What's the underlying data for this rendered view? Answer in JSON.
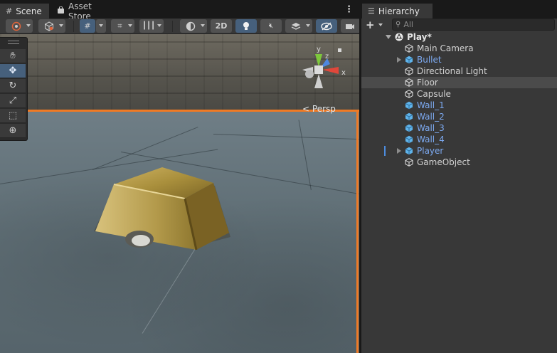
{
  "scene_panel": {
    "tabs": [
      {
        "label": "Scene",
        "icon": "grid-icon",
        "active": true
      },
      {
        "label": "Asset Store",
        "icon": "bag-icon",
        "active": false
      }
    ],
    "toolbar": {
      "mode_2d_label": "2D"
    },
    "tools": [
      "hand-tool",
      "move-tool",
      "rotate-tool",
      "scale-tool",
      "rect-tool",
      "transform-tool"
    ],
    "active_tool": "move-tool",
    "gizmo": {
      "axis_x": "x",
      "axis_y": "y",
      "axis_z": "z",
      "projection_label": "Persp"
    },
    "colors": {
      "selection_outline": "#f07a25",
      "active_button": "#46607c"
    }
  },
  "hierarchy": {
    "tab_label": "Hierarchy",
    "add_button_label": "+",
    "search_placeholder": "All",
    "scene_name": "Play*",
    "items": [
      {
        "label": "Main Camera",
        "icon": "gameobject-icon",
        "prefab": false,
        "expandable": false
      },
      {
        "label": "Bullet",
        "icon": "prefab-icon",
        "prefab": true,
        "expandable": true
      },
      {
        "label": "Directional Light",
        "icon": "gameobject-icon",
        "prefab": false,
        "expandable": false
      },
      {
        "label": "Floor",
        "icon": "gameobject-icon",
        "prefab": false,
        "expandable": false,
        "highlighted": true
      },
      {
        "label": "Capsule",
        "icon": "gameobject-icon",
        "prefab": false,
        "expandable": false
      },
      {
        "label": "Wall_1",
        "icon": "prefab-icon",
        "prefab": true,
        "expandable": false
      },
      {
        "label": "Wall_2",
        "icon": "prefab-icon",
        "prefab": true,
        "expandable": false
      },
      {
        "label": "Wall_3",
        "icon": "prefab-icon",
        "prefab": true,
        "expandable": false
      },
      {
        "label": "Wall_4",
        "icon": "prefab-icon",
        "prefab": true,
        "expandable": false
      },
      {
        "label": "Player",
        "icon": "prefab-icon",
        "prefab": true,
        "expandable": true,
        "modified": true
      },
      {
        "label": "GameObject",
        "icon": "gameobject-icon",
        "prefab": false,
        "expandable": false
      }
    ],
    "colors": {
      "prefab_text": "#7ca9f0",
      "prefab_icon": "#5fb3ea",
      "highlight_row": "#4b4b4b"
    }
  }
}
